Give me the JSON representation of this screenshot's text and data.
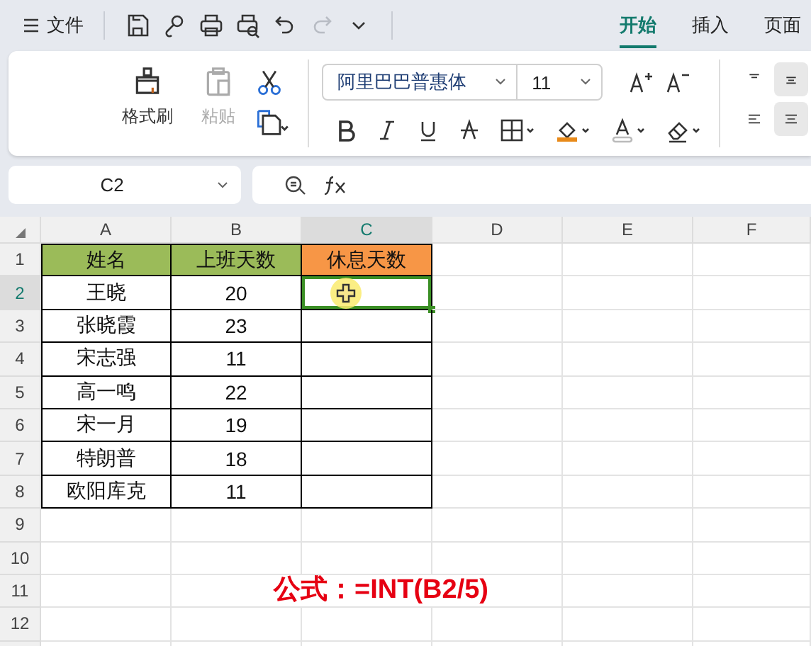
{
  "title_bar": {
    "menu_label": "文件",
    "quick_tools": [
      {
        "kind": "save",
        "disabled": false
      },
      {
        "kind": "share",
        "disabled": false
      },
      {
        "kind": "print",
        "disabled": false
      },
      {
        "kind": "preview",
        "disabled": false
      },
      {
        "kind": "undo",
        "disabled": false
      },
      {
        "kind": "redo",
        "disabled": true
      },
      {
        "kind": "more",
        "disabled": false
      }
    ],
    "tabs": [
      {
        "label": "开始",
        "selected": true
      },
      {
        "label": "插入",
        "selected": false
      },
      {
        "label": "页面",
        "selected": false
      }
    ]
  },
  "ribbon": {
    "clipboard": [
      {
        "kind": "painter",
        "label": "格式刷",
        "disabled": false
      },
      {
        "kind": "paste",
        "label": "粘贴",
        "disabled": true
      }
    ],
    "font": {
      "family": "阿里巴巴普惠体",
      "size": "11"
    },
    "align": [
      {
        "kind": "top",
        "selected": false
      },
      {
        "kind": "middle",
        "selected": true
      },
      {
        "kind": "left",
        "selected": false
      },
      {
        "kind": "center",
        "selected": true
      }
    ]
  },
  "formula_bar": {
    "cell_ref": "C2"
  },
  "sheet": {
    "columns": [
      {
        "label": "A",
        "selected": false
      },
      {
        "label": "B",
        "selected": false
      },
      {
        "label": "C",
        "selected": true
      },
      {
        "label": "D",
        "selected": false
      },
      {
        "label": "E",
        "selected": false
      },
      {
        "label": "F",
        "selected": false
      }
    ],
    "rows": [
      {
        "label": "1",
        "selected": false
      },
      {
        "label": "2",
        "selected": true
      },
      {
        "label": "3",
        "selected": false
      },
      {
        "label": "4",
        "selected": false
      },
      {
        "label": "5",
        "selected": false
      },
      {
        "label": "6",
        "selected": false
      },
      {
        "label": "7",
        "selected": false
      },
      {
        "label": "8",
        "selected": false
      },
      {
        "label": "9",
        "selected": false
      },
      {
        "label": "10",
        "selected": false
      },
      {
        "label": "11",
        "selected": false
      },
      {
        "label": "12",
        "selected": false
      }
    ],
    "header_cells": [
      {
        "text": "姓名",
        "color": "#9bbb59"
      },
      {
        "text": "上班天数",
        "color": "#9bbb59"
      },
      {
        "text": "休息天数",
        "color": "#f79646"
      }
    ],
    "data_rows": [
      {
        "cells": [
          "王晓",
          "20"
        ],
        "selected": true
      },
      {
        "cells": [
          "张晓霞",
          "23"
        ],
        "selected": false
      },
      {
        "cells": [
          "宋志强",
          "11"
        ],
        "selected": false
      },
      {
        "cells": [
          "高一鸣",
          "22"
        ],
        "selected": false
      },
      {
        "cells": [
          "宋一月",
          "19"
        ],
        "selected": false
      },
      {
        "cells": [
          "特朗普",
          "18"
        ],
        "selected": false
      },
      {
        "cells": [
          "欧阳库克",
          "11"
        ],
        "selected": false
      }
    ],
    "annotation": "公式：=INT(B2/5)"
  }
}
